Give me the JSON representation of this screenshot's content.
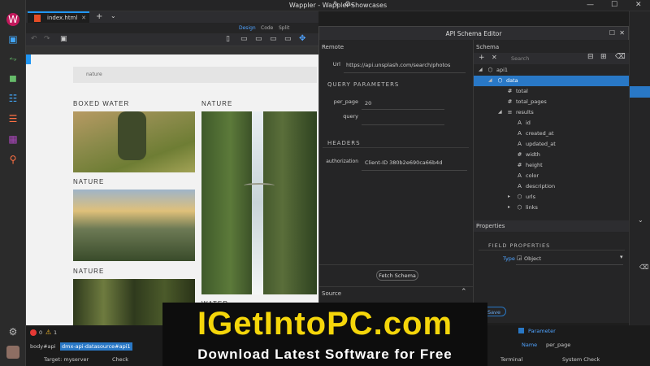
{
  "app": {
    "title": "Wappler - Wappler-Showcases"
  },
  "tabs": [
    {
      "label": "index.html"
    }
  ],
  "modes": {
    "design": "Design",
    "code": "Code",
    "split": "Split"
  },
  "page": {
    "search_placeholder": "nature",
    "sections": [
      "BOXED WATER",
      "NATURE",
      "NATURE",
      "NATURE",
      "WATER"
    ]
  },
  "dialog": {
    "title": "API Schema Editor",
    "remote": {
      "header": "Remote",
      "url_label": "Url",
      "url_value": "https://api.unsplash.com/search/photos"
    },
    "query": {
      "header": "QUERY PARAMETERS",
      "per_page_label": "per_page",
      "per_page_value": "20",
      "query_label": "query",
      "query_value": ""
    },
    "headers": {
      "header": "HEADERS",
      "auth_label": "authorization",
      "auth_value": "Client-ID 380b2e690ca66b4d"
    },
    "fetch_button": "Fetch Schema",
    "source_label": "Source",
    "schema": {
      "header": "Schema",
      "search_placeholder": "Search",
      "tree": [
        {
          "label": "api1",
          "icon": "cube-icon",
          "indent": 0,
          "expanded": "down"
        },
        {
          "label": "data",
          "icon": "cube-icon",
          "indent": 1,
          "expanded": "down",
          "selected": true
        },
        {
          "label": "total",
          "icon": "hash-icon",
          "indent": 2
        },
        {
          "label": "total_pages",
          "icon": "hash-icon",
          "indent": 2
        },
        {
          "label": "results",
          "icon": "list-icon",
          "indent": 2,
          "expanded": "down"
        },
        {
          "label": "id",
          "icon": "text-icon",
          "indent": 3
        },
        {
          "label": "created_at",
          "icon": "text-icon",
          "indent": 3
        },
        {
          "label": "updated_at",
          "icon": "text-icon",
          "indent": 3
        },
        {
          "label": "width",
          "icon": "hash-icon",
          "indent": 3
        },
        {
          "label": "height",
          "icon": "hash-icon",
          "indent": 3
        },
        {
          "label": "color",
          "icon": "text-icon",
          "indent": 3
        },
        {
          "label": "description",
          "icon": "text-icon",
          "indent": 3
        },
        {
          "label": "urls",
          "icon": "cube-icon",
          "indent": 3,
          "expanded": "right"
        },
        {
          "label": "links",
          "icon": "cube-icon",
          "indent": 3,
          "expanded": "right"
        }
      ]
    },
    "properties": {
      "header": "Properties",
      "field_header": "FIELD PROPERTIES",
      "type_label": "Type",
      "type_value": "Object"
    }
  },
  "status": {
    "errors": "0",
    "warnings": "1",
    "breadcrumb": [
      "body#api",
      "dmx-api-datasource#api1"
    ],
    "target": "Target: myserver",
    "check": "Check",
    "terminal": "Terminal",
    "system_check": "System Check",
    "parameter": "Parameter",
    "name_label": "Name",
    "name_value": "per_page",
    "save": "Save"
  },
  "watermark": {
    "line1": "IGetIntoPC.com",
    "line2": "Download Latest Software for Free"
  },
  "colors": {
    "accent": "#2978c6",
    "tab_accent": "#2196f3",
    "banner_yellow": "#f5d60a"
  }
}
